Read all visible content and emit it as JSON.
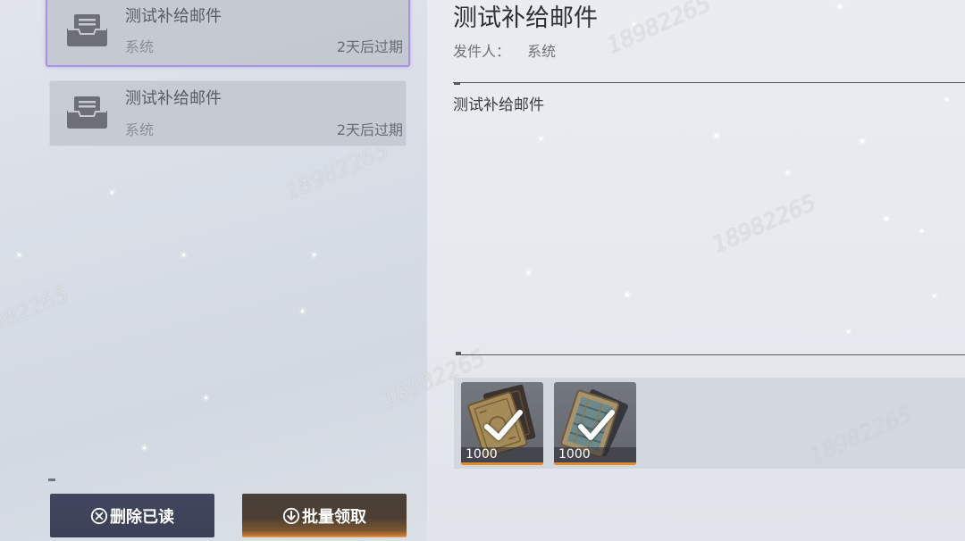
{
  "mail_list": [
    {
      "title": "测试补给邮件",
      "sender": "系统",
      "expiry": "2天后过期",
      "icon": "mail-tray-icon",
      "selected": true
    },
    {
      "title": "测试补给邮件",
      "sender": "系统",
      "expiry": "2天后过期",
      "icon": "mail-tray-icon",
      "selected": false
    }
  ],
  "actions": {
    "delete_read": {
      "label": "删除已读",
      "icon": "circle-x-icon"
    },
    "batch_claim": {
      "label": "批量领取",
      "icon": "circle-download-icon"
    }
  },
  "detail": {
    "title": "测试补给邮件",
    "sender_label": "发件人：",
    "sender": "系统",
    "body": "测试补给邮件",
    "rewards": [
      {
        "count": "1000",
        "icon": "gold-card-item-icon",
        "claimed": true
      },
      {
        "count": "1000",
        "icon": "pattern-card-item-icon",
        "claimed": true
      }
    ]
  },
  "watermark": "18982265",
  "colors": {
    "selected_border": "#a892e8",
    "delete_button": "#3b4056",
    "claim_button_glow": "#f0a050",
    "reward_bar": "#e38a2e"
  }
}
